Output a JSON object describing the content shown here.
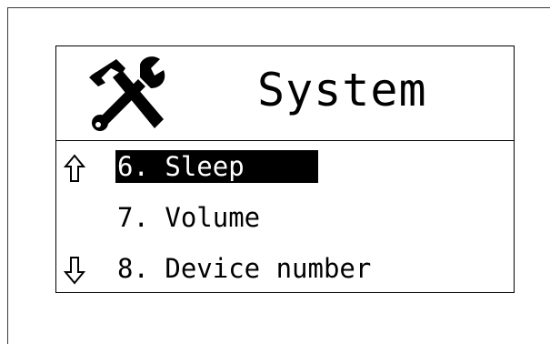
{
  "screen": {
    "title": "System",
    "title_icon": "tools-icon"
  },
  "menu": {
    "items": [
      {
        "label": "6. Sleep",
        "selected": true
      },
      {
        "label": "7. Volume",
        "selected": false
      },
      {
        "label": "8. Device number",
        "selected": false
      }
    ],
    "scroll_up_icon": "arrow-up-icon",
    "scroll_down_icon": "arrow-down-icon"
  },
  "colors": {
    "background": "#ffffff",
    "foreground": "#000000",
    "highlight_bg": "#000000",
    "highlight_fg": "#ffffff"
  }
}
